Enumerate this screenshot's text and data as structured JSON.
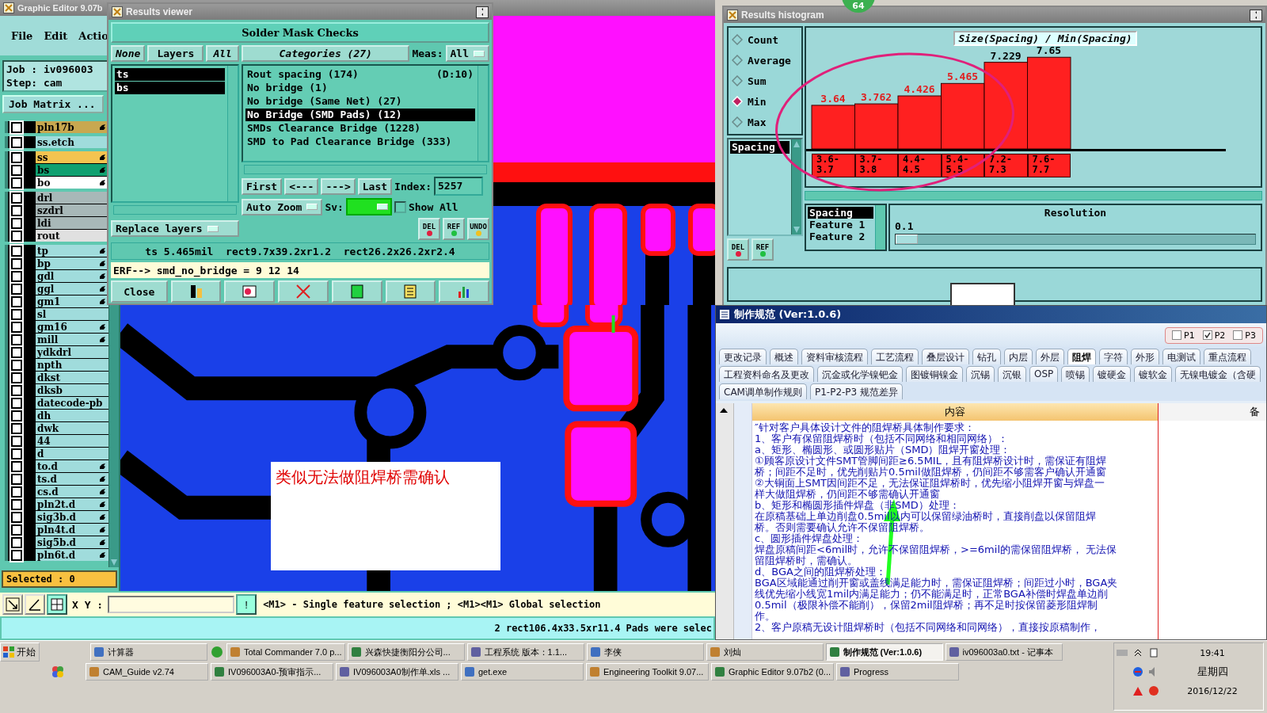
{
  "editor": {
    "title": "Graphic Editor 9.07b",
    "menu": [
      "File",
      "Edit",
      "Actio"
    ],
    "job": "Job : iv096003",
    "step": "Step: cam",
    "job_matrix": "Job Matrix ...",
    "groups": [
      {
        "layers": [
          {
            "name": "pln17b",
            "color": "#c8a850",
            "pointer": true,
            "checked": false
          }
        ]
      },
      {
        "layers": [
          {
            "name": "ss.etch",
            "color": "#a0dcdc",
            "pointer": false,
            "checked": false
          }
        ]
      },
      {
        "layers": [
          {
            "name": "ss",
            "color": "#f4c450",
            "pointer": true,
            "checked": false
          },
          {
            "name": "bs",
            "color": "#10a070",
            "pointer": true,
            "checked": false
          },
          {
            "name": "bo",
            "color": "#ffffff",
            "pointer": true,
            "checked": false
          }
        ]
      },
      {
        "layers": [
          {
            "name": "drl",
            "color": "#a8b8b8",
            "pointer": false,
            "checked": false
          },
          {
            "name": "szdrl",
            "color": "#a8b8b8",
            "pointer": false,
            "checked": false
          },
          {
            "name": "ldi",
            "color": "#a8b8b8",
            "pointer": false,
            "checked": false
          },
          {
            "name": "rout",
            "color": "#e0e0e0",
            "pointer": false,
            "checked": false
          }
        ]
      },
      {
        "layers": [
          {
            "name": "tp",
            "color": "#a0dcdc",
            "pointer": true,
            "checked": false
          },
          {
            "name": "bp",
            "color": "#a0dcdc",
            "pointer": true,
            "checked": false
          },
          {
            "name": "gdl",
            "color": "#a0dcdc",
            "pointer": true,
            "checked": false
          },
          {
            "name": "ggl",
            "color": "#a0dcdc",
            "pointer": true,
            "checked": false
          },
          {
            "name": "gm1",
            "color": "#a0dcdc",
            "pointer": true,
            "checked": false
          },
          {
            "name": "sl",
            "color": "#a0dcdc",
            "pointer": false,
            "checked": false
          },
          {
            "name": "gm16",
            "color": "#a0dcdc",
            "pointer": true,
            "checked": false
          },
          {
            "name": "mill",
            "color": "#a0dcdc",
            "pointer": true,
            "checked": false
          },
          {
            "name": "ydkdrl",
            "color": "#a0dcdc",
            "pointer": false,
            "checked": false
          },
          {
            "name": "npth",
            "color": "#a0dcdc",
            "pointer": false,
            "checked": false
          },
          {
            "name": "dkst",
            "color": "#a0dcdc",
            "pointer": false,
            "checked": false
          },
          {
            "name": "dksb",
            "color": "#a0dcdc",
            "pointer": false,
            "checked": false
          },
          {
            "name": "datecode-pb",
            "color": "#a0dcdc",
            "pointer": false,
            "checked": false
          },
          {
            "name": "dh",
            "color": "#a0dcdc",
            "pointer": false,
            "checked": false
          },
          {
            "name": "dwk",
            "color": "#a0dcdc",
            "pointer": false,
            "checked": false
          },
          {
            "name": "44",
            "color": "#a0dcdc",
            "pointer": false,
            "checked": false
          },
          {
            "name": "d",
            "color": "#a0dcdc",
            "pointer": false,
            "checked": false
          },
          {
            "name": "to.d",
            "color": "#a0dcdc",
            "pointer": true,
            "checked": false
          },
          {
            "name": "ts.d",
            "color": "#a0dcdc",
            "pointer": true,
            "checked": false
          },
          {
            "name": "cs.d",
            "color": "#a0dcdc",
            "pointer": true,
            "checked": false
          },
          {
            "name": "pln2t.d",
            "color": "#a0dcdc",
            "pointer": true,
            "checked": false
          },
          {
            "name": "sig3b.d",
            "color": "#a0dcdc",
            "pointer": true,
            "checked": false
          },
          {
            "name": "pln4t.d",
            "color": "#a0dcdc",
            "pointer": true,
            "checked": false
          },
          {
            "name": "sig5b.d",
            "color": "#a0dcdc",
            "pointer": true,
            "checked": false
          },
          {
            "name": "pln6t.d",
            "color": "#a0dcdc",
            "pointer": true,
            "checked": false
          }
        ]
      }
    ],
    "selected_count": "Selected : 0",
    "note": "类似无法做阻焊桥需确认",
    "xy_label": "X Y :",
    "alert": "!",
    "hint": "<M1> - Single feature selection ; <M1><M1> Global selection",
    "status": "2 rect106.4x33.5xr11.4 Pads were selec"
  },
  "viewer": {
    "title": "Results viewer",
    "header": "Solder Mask Checks",
    "layer_buttons": [
      "None",
      "Layers",
      "All"
    ],
    "layers": [
      {
        "label": "ts",
        "selected": true
      },
      {
        "label": "bs",
        "selected": true
      }
    ],
    "replace": "Replace layers",
    "categories_button": "Categories (27)",
    "meas_label": "Meas:",
    "meas_value": "All",
    "categories": [
      {
        "label": "Rout spacing (174)",
        "extra": "(D:10)",
        "selected": false
      },
      {
        "label": "No bridge (1)",
        "selected": false
      },
      {
        "label": "No bridge (Same Net) (27)",
        "selected": false
      },
      {
        "label": "No Bridge (SMD Pads) (12)",
        "selected": true
      },
      {
        "label": "SMDs Clearance Bridge (1228)",
        "selected": false
      },
      {
        "label": "SMD to Pad Clearance Bridge (333)",
        "selected": false
      }
    ],
    "nav": [
      "First",
      "<---",
      "--->",
      "Last"
    ],
    "index_label": "Index:",
    "index_value": "5257",
    "zoom": "Auto Zoom",
    "sv_label": "Sv:",
    "show_all": {
      "label": "Show All",
      "checked": false
    },
    "tools": [
      "DEL",
      "REF",
      "UNDO"
    ],
    "info": "ts 5.465mil  rect9.7x39.2xr1.2  rect26.2x26.2xr2.4",
    "erf": "ERF--> smd_no_bridge = 9 12 14",
    "close": "Close"
  },
  "badge": "64",
  "histogram": {
    "title": "Results histogram",
    "modes": [
      {
        "label": "Count",
        "selected": false
      },
      {
        "label": "Average",
        "selected": false
      },
      {
        "label": "Sum",
        "selected": false
      },
      {
        "label": "Min",
        "selected": true
      },
      {
        "label": "Max",
        "selected": false
      }
    ],
    "list": [
      {
        "label": "Spacing",
        "selected": true
      }
    ],
    "tools": [
      "DEL",
      "REF"
    ],
    "chart_data": {
      "type": "bar",
      "title": "Size(Spacing) / Min(Spacing)",
      "categories": [
        "3.6-3.7",
        "3.7-3.8",
        "4.4-4.5",
        "5.4-5.5",
        "7.2-7.3",
        "7.6-7.7"
      ],
      "values": [
        3.64,
        3.762,
        4.426,
        5.465,
        7.229,
        7.65
      ],
      "value_labels": [
        "3.64",
        "3.762",
        "4.426",
        "5.465",
        "7.229",
        "7.65"
      ]
    },
    "fields": [
      {
        "label": "Spacing",
        "selected": true
      },
      {
        "label": "Feature 1",
        "selected": false
      },
      {
        "label": "Feature 2",
        "selected": false
      }
    ],
    "resolution_label": "Resolution",
    "resolution_value": "0.1",
    "resolution_slider": {
      "level": 0
    }
  },
  "spec": {
    "title": "制作规范 (Ver:1.0.6)",
    "levels": [
      {
        "label": "P1",
        "checked": false
      },
      {
        "label": "P2",
        "checked": true
      },
      {
        "label": "P3",
        "checked": false
      }
    ],
    "tab_rows": [
      [
        {
          "label": "更改记录",
          "selected": false
        },
        {
          "label": "概述",
          "selected": false
        },
        {
          "label": "资料审核流程",
          "selected": false
        },
        {
          "label": "工艺流程",
          "selected": false
        },
        {
          "label": "叠层设计",
          "selected": false
        },
        {
          "label": "钻孔",
          "selected": false
        },
        {
          "label": "内层",
          "selected": false
        },
        {
          "label": "外层",
          "selected": false
        },
        {
          "label": "阻焊",
          "selected": true
        },
        {
          "label": "字符",
          "selected": false
        },
        {
          "label": "外形",
          "selected": false
        },
        {
          "label": "电测试",
          "selected": false
        },
        {
          "label": "重点流程",
          "selected": false
        }
      ],
      [
        {
          "label": "工程资料命名及更改",
          "selected": false
        },
        {
          "label": "沉金或化学镍钯金",
          "selected": false
        },
        {
          "label": "图镀铜镍金",
          "selected": false
        },
        {
          "label": "沉锡",
          "selected": false
        },
        {
          "label": "沉银",
          "selected": false
        },
        {
          "label": "OSP",
          "selected": false
        },
        {
          "label": "喷锡",
          "selected": false
        },
        {
          "label": "镀硬金",
          "selected": false
        },
        {
          "label": "镀软金",
          "selected": false
        },
        {
          "label": "无镍电镀金（含硬",
          "selected": false
        }
      ],
      [
        {
          "label": "CAM调单制作规则",
          "selected": false
        },
        {
          "label": "P1-P2-P3 规范差异",
          "selected": false
        }
      ]
    ],
    "columns": [
      "内容",
      "备"
    ],
    "lines": [
      "″针对客户具体设计文件的阻焊桥具体制作要求：",
      "1、客户有保留阻焊桥时（包括不同网络和相同网络）：",
      "a、矩形、椭圆形、或圆形贴片（SMD）阻焊开窗处理：",
      "①顾客原设计文件SMT管脚间距≥6.5MIL，且有阻焊桥设计时，需保证有阻焊",
      "桥；间距不足时，优先削贴片0.5mil做阻焊桥，仍间距不够需客户确认开通窗",
      "②大铜面上SMT因间距不足，无法保证阻焊桥时，优先缩小阻焊开窗与焊盘一",
      "样大做阻焊桥，仍间距不够需确认开通窗",
      "b、矩形和椭圆形插件焊盘（非SMD）处理：",
      "在原稿基础上单边削盘0.5mil以内可以保留绿油桥时，直接削盘以保留阻焊",
      "桥。否则需要确认允许不保留阻焊桥。",
      "c、圆形插件焊盘处理：",
      "焊盘原稿间距<6mil时，允许不保留阻焊桥，>=6mil的需保留阻焊桥， 无法保",
      "留阻焊桥时，需确认。",
      "d、BGA之间的阻焊桥处理：",
      "BGA区域能通过削开窗或盖线满足能力时，需保证阻焊桥；间距过小时，BGA夹",
      "线优先缩小线宽1mil内满足能力；仍不能满足时，正常BGA补偿时焊盘单边削",
      "0.5mil（极限补偿不能削），保留2mil阻焊桥；再不足时按保留菱形阻焊制",
      "作。",
      "2、客户原稿无设计阻焊桥时（包括不同网络和同网络），直接按原稿制作，"
    ]
  },
  "taskbar": {
    "start": "开始",
    "rows": [
      [
        {
          "label": "计算器",
          "selected": false
        },
        {
          "label": "Total Commander 7.0 p...",
          "selected": false
        },
        {
          "label": "兴森快捷衡阳分公司...",
          "selected": false
        },
        {
          "label": "工程系统  版本：1.1...",
          "selected": false
        },
        {
          "label": "李侠",
          "selected": false
        },
        {
          "label": "刘灿",
          "selected": false
        },
        {
          "label": "制作规范 (Ver:1.0.6)",
          "selected": true
        },
        {
          "label": "iv096003a0.txt - 记事本",
          "selected": false
        }
      ],
      [
        {
          "label": "CAM_Guide v2.74",
          "selected": false
        },
        {
          "label": "IV096003A0-预审指示...",
          "selected": false
        },
        {
          "label": "IV096003A0制作单.xls ...",
          "selected": false
        },
        {
          "label": "get.exe",
          "selected": false
        },
        {
          "label": "Engineering Toolkit 9.07...",
          "selected": false
        },
        {
          "label": "Graphic Editor 9.07b2 (0...",
          "selected": false
        },
        {
          "label": "Progress",
          "selected": false
        }
      ]
    ],
    "time": "19:41",
    "weekday": "星期四",
    "date": "2016/12/22"
  }
}
